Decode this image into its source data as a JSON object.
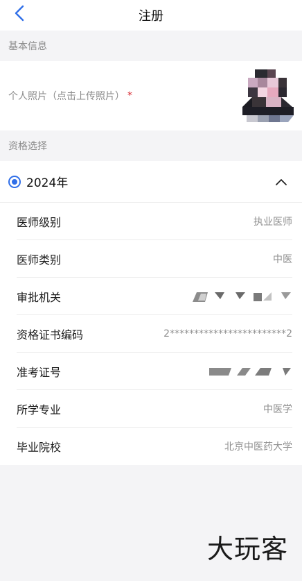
{
  "header": {
    "title": "注册",
    "back_icon": "chevron-left-icon"
  },
  "basic_info": {
    "section_label": "基本信息",
    "photo_label": "个人照片（点击上传照片）",
    "required_mark": "*"
  },
  "qualification": {
    "section_label": "资格选择",
    "year": "2024年",
    "selected": true,
    "expanded": true,
    "fields": [
      {
        "label": "医师级别",
        "value": "执业医师"
      },
      {
        "label": "医师类别",
        "value": "中医"
      },
      {
        "label": "审批机关",
        "value": ""
      },
      {
        "label": "资格证书编码",
        "value": "2************************2"
      },
      {
        "label": "准考证号",
        "value": ""
      },
      {
        "label": "所学专业",
        "value": "中医学"
      },
      {
        "label": "毕业院校",
        "value": "北京中医药大学"
      }
    ]
  },
  "watermark": "大玩客",
  "colors": {
    "accent": "#2f6ee8",
    "required": "#d6232b",
    "muted": "#8a8a8a",
    "background": "#f4f4f6"
  }
}
